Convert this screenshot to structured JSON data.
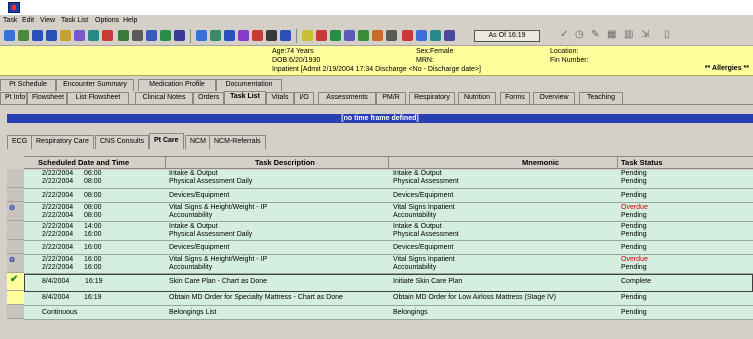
{
  "menu": [
    "Task",
    "Edit",
    "View",
    "Task List",
    "Options",
    "Help"
  ],
  "toolbar": {
    "as_of": "As Of 16:19"
  },
  "banner": {
    "age": "Age:74 Years",
    "dob": "DOB:6/20/1930",
    "inpatient": "Inpatient [Admit 2/19/2004 17:34  Discharge <No - Discharge date>]",
    "sex": "Sex:Female",
    "mrn": "MRN:",
    "location": "Location:",
    "fin": "Fin Number:",
    "allergies": "** Allergies **"
  },
  "tabs_row1": [
    "Pt Schedule",
    "Encounter Summary",
    "Medication Profile",
    "Documentation"
  ],
  "tabs_row2": [
    "Pt Info",
    "Flowsheet",
    "List Flowsheet",
    "Clinical Notes",
    "Orders",
    "Task List",
    "Vitals",
    "I/O",
    "Assessments",
    "PM/R",
    "Respiratory",
    "Nutrition",
    "Forms",
    "Overview",
    "Teaching"
  ],
  "time_frame": "[no time frame defined]",
  "subtabs": [
    "ECG",
    "Respiratory Care",
    "CNS Consults",
    "Pt Care",
    "NCM",
    "NCM-Referrals"
  ],
  "grid": {
    "headers": [
      "Scheduled Date and Time",
      "Task Description",
      "Mnemonic",
      "Task Status"
    ],
    "rows": [
      {
        "date": "2/22/2004",
        "time": "06:00",
        "desc": "Intake & Output",
        "mnemonic": "Intake & Output",
        "status": "Pending"
      },
      {
        "date": "2/22/2004",
        "time": "08:00",
        "desc": "Physical Assessment Daily",
        "mnemonic": "Physical Assessment",
        "status": "Pending"
      },
      {
        "date": "2/22/2004",
        "time": "08:00",
        "desc": "Devices/Equipment",
        "mnemonic": "Devices/Equipment",
        "status": "Pending"
      },
      {
        "date": "2/22/2004",
        "time": "08:00",
        "desc": "Vital Signs & Height/Weight - IP",
        "mnemonic": "Vital Signs Inpatient",
        "status": "Overdue"
      },
      {
        "date": "2/22/2004",
        "time": "08:00",
        "desc": "Accountability",
        "mnemonic": "Accountability",
        "status": "Pending"
      },
      {
        "date": "2/22/2004",
        "time": "14:00",
        "desc": "Intake & Output",
        "mnemonic": "Intake & Output",
        "status": "Pending"
      },
      {
        "date": "2/22/2004",
        "time": "16:00",
        "desc": "Physical Assessment Daily",
        "mnemonic": "Physical Assessment",
        "status": "Pending"
      },
      {
        "date": "2/22/2004",
        "time": "16:00",
        "desc": "Devices/Equipment",
        "mnemonic": "Devices/Equipment",
        "status": "Pending"
      },
      {
        "date": "2/22/2004",
        "time": "16:00",
        "desc": "Vital Signs & Height/Weight - IP",
        "mnemonic": "Vital Signs Inpatient",
        "status": "Overdue"
      },
      {
        "date": "2/22/2004",
        "time": "16:00",
        "desc": "Accountability",
        "mnemonic": "Accountability",
        "status": "Pending"
      },
      {
        "date": "8/4/2004",
        "time": "16:19",
        "desc": "Skin Care Plan - Chart as Done",
        "mnemonic": "Initiate Skin Care Plan",
        "status": "Complete"
      },
      {
        "date": "8/4/2004",
        "time": "16:19",
        "desc": "Obtain MD Order for Specialty Mattress - Chart as Done",
        "mnemonic": "Obtain MD Order for Low Airloss Mattress (Stage IV)",
        "status": "Pending"
      },
      {
        "date": "Continuous",
        "time": "",
        "desc": "Belongings List",
        "mnemonic": "Belongings",
        "status": "Pending"
      }
    ]
  },
  "colors": {
    "accent_band": "#2a3fb4",
    "banner_bg": "#ffff9e",
    "row_bg": "#d4efe0",
    "overdue": "#d00000"
  }
}
